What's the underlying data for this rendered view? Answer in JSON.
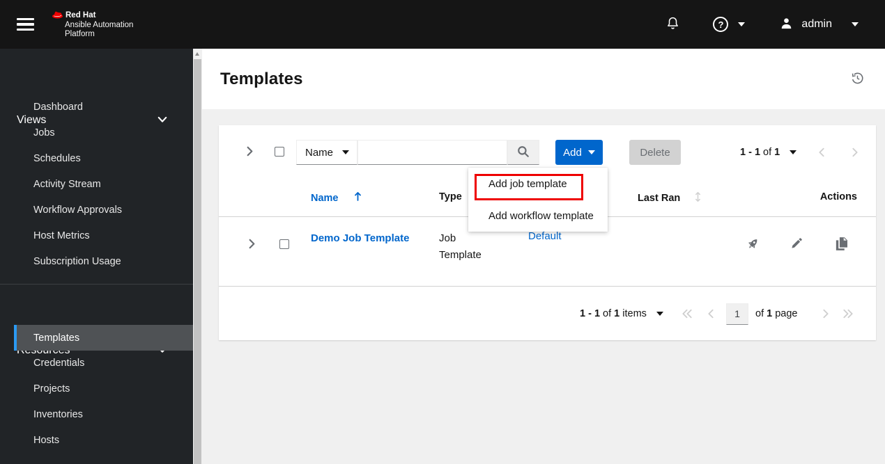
{
  "navbar": {
    "brand_line1": "Red Hat",
    "brand_line2": "Ansible Automation",
    "brand_line3": "Platform",
    "username": "admin"
  },
  "sidebar": {
    "sections": [
      {
        "label": "Views",
        "items": [
          {
            "label": "Dashboard"
          },
          {
            "label": "Jobs"
          },
          {
            "label": "Schedules"
          },
          {
            "label": "Activity Stream"
          },
          {
            "label": "Workflow Approvals"
          },
          {
            "label": "Host Metrics"
          },
          {
            "label": "Subscription Usage"
          }
        ]
      },
      {
        "label": "Resources",
        "items": [
          {
            "label": "Templates"
          },
          {
            "label": "Credentials"
          },
          {
            "label": "Projects"
          },
          {
            "label": "Inventories"
          },
          {
            "label": "Hosts"
          }
        ]
      }
    ],
    "active_item": "Templates"
  },
  "page": {
    "title": "Templates"
  },
  "toolbar": {
    "filter_selected": "Name",
    "search_value": "",
    "add_label": "Add",
    "delete_label": "Delete",
    "pagination": {
      "range": "1 - 1",
      "of_word": "of",
      "total": "1"
    }
  },
  "add_menu": {
    "items": [
      {
        "label": "Add job template"
      },
      {
        "label": "Add workflow template"
      }
    ],
    "highlighted": "Add job template"
  },
  "table": {
    "headers": {
      "name": "Name",
      "type": "Type",
      "last_ran": "Last Ran",
      "actions": "Actions"
    },
    "rows": [
      {
        "name": "Demo Job Template",
        "type": "Job Template",
        "organization": "Default"
      }
    ]
  },
  "footer_pagination": {
    "range": "1 - 1",
    "of_word": "of",
    "total": "1",
    "items_word": "items",
    "page_value": "1",
    "of_word2": "of",
    "page_count": "1",
    "page_word": "page"
  },
  "colors": {
    "link": "#0066cc",
    "primary_button": "#0066cc",
    "active_indicator": "#2b9af3",
    "annotation_border": "#ee0000",
    "navbar_bg": "#151515",
    "sidebar_bg": "#212427",
    "page_bg": "#f0f0f0"
  }
}
